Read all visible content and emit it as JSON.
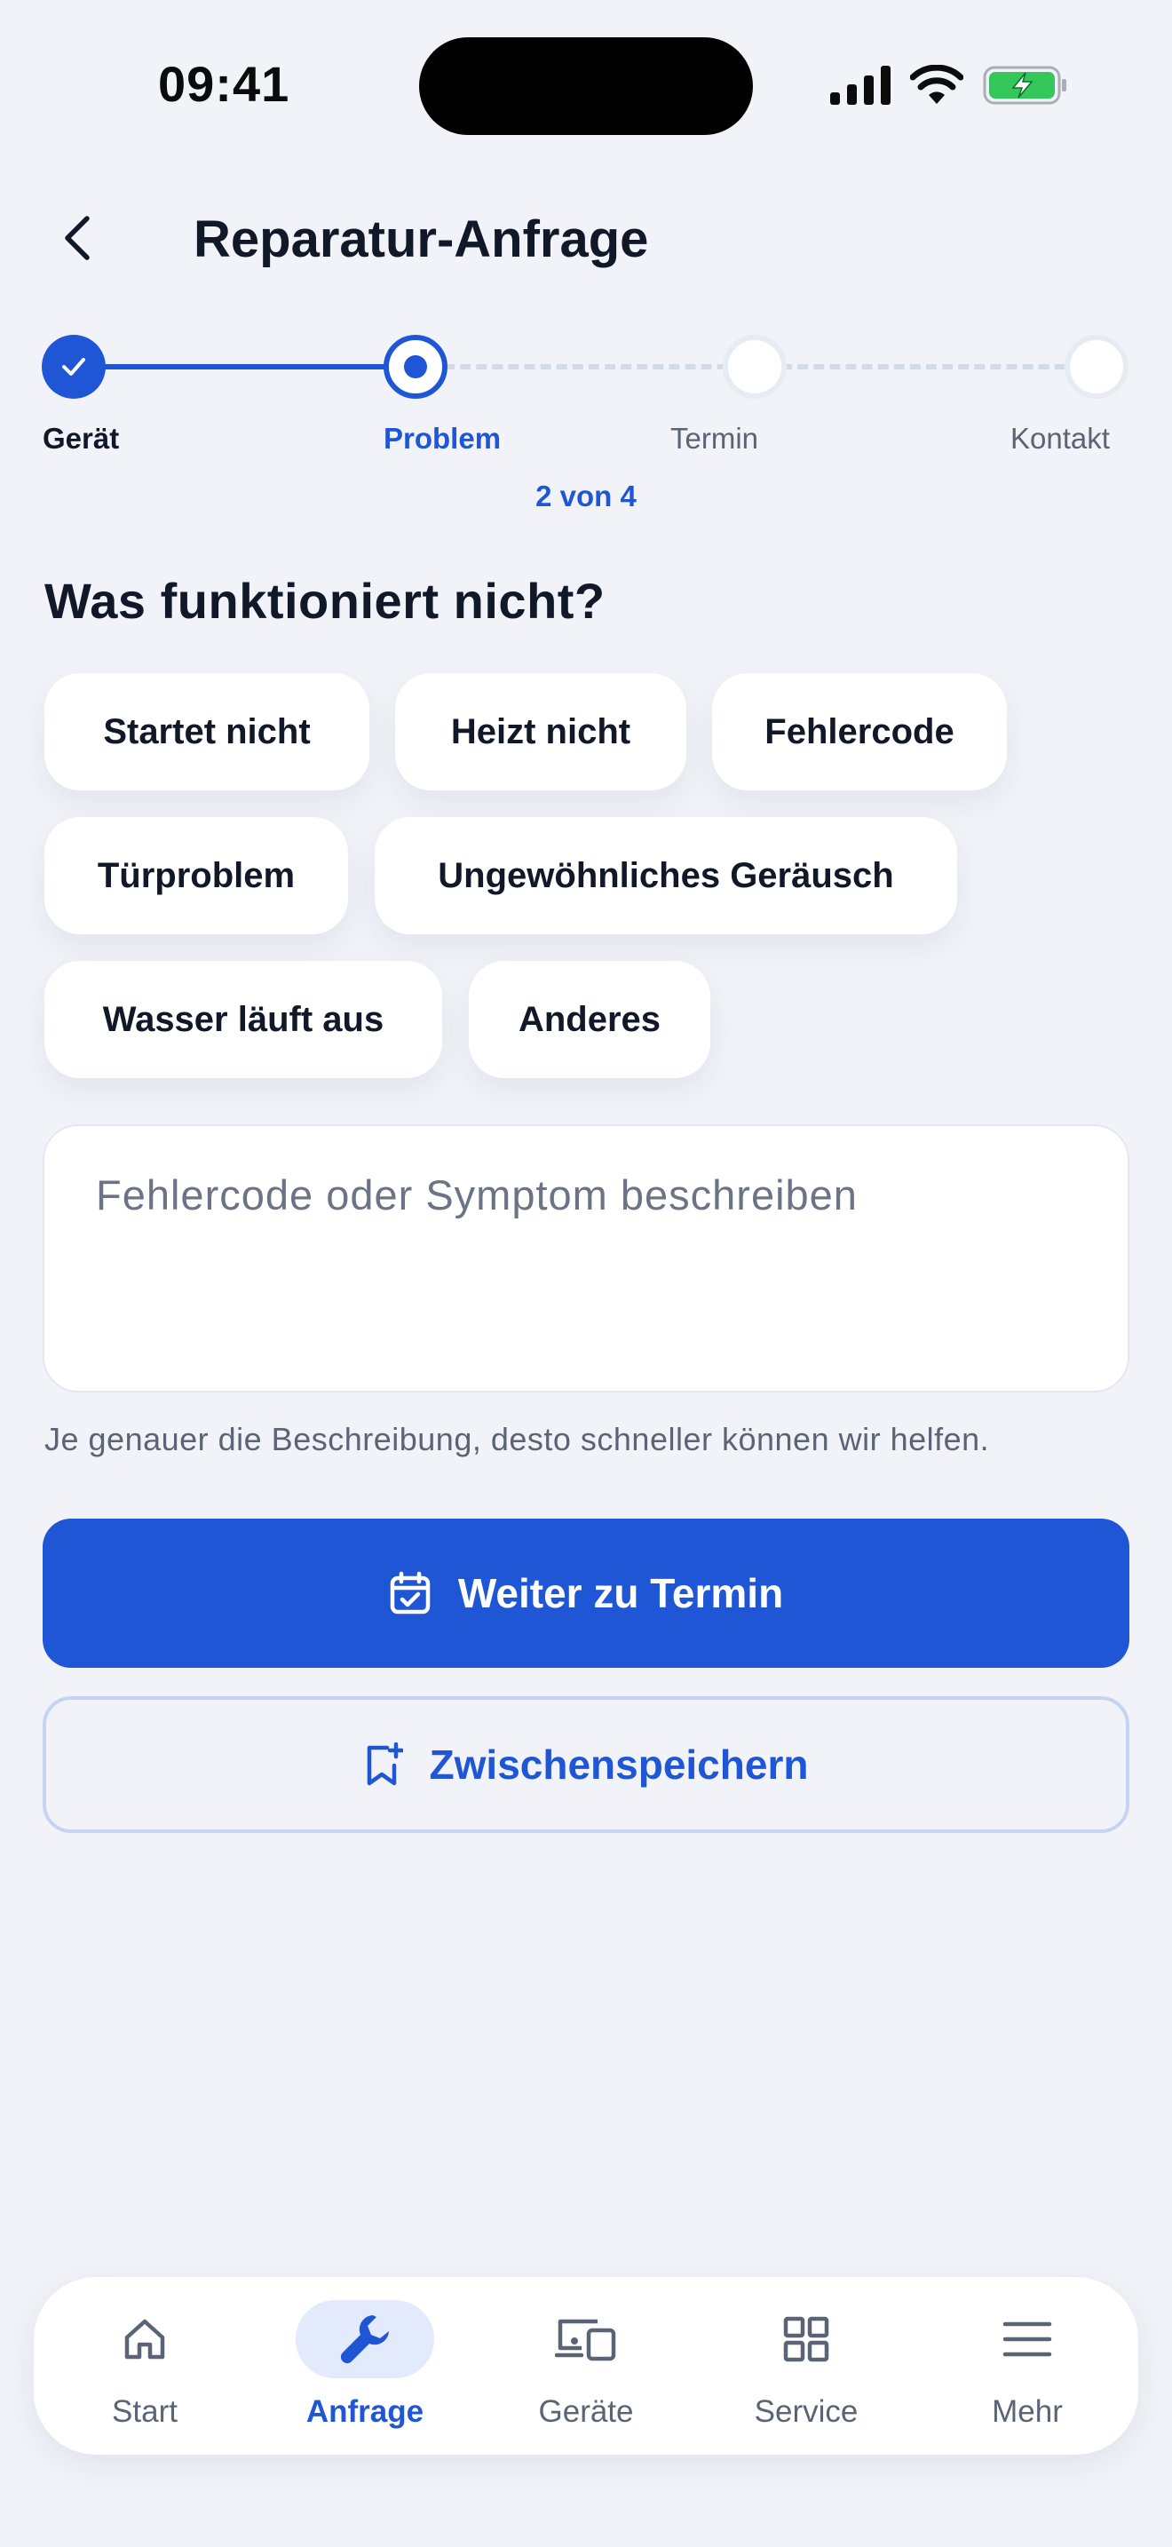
{
  "status_bar": {
    "time": "09:41"
  },
  "header": {
    "title": "Reparatur-Anfrage"
  },
  "stepper": {
    "steps": [
      {
        "label": "Gerät",
        "state": "done"
      },
      {
        "label": "Problem",
        "state": "current"
      },
      {
        "label": "Termin",
        "state": "pending"
      },
      {
        "label": "Kontakt",
        "state": "pending"
      }
    ],
    "progress_text": "2 von 4"
  },
  "question": "Was funktioniert nicht?",
  "chips": [
    "Startet nicht",
    "Heizt nicht",
    "Fehlercode",
    "Türproblem",
    "Ungewöhnliches Geräusch",
    "Wasser läuft aus",
    "Anderes"
  ],
  "description": {
    "value": "",
    "placeholder": "Fehlercode oder Symptom beschreiben",
    "helper": "Je genauer die Beschreibung, desto schneller können wir helfen."
  },
  "buttons": {
    "primary_label": "Weiter zu Termin",
    "primary_icon": "calendar-check-icon",
    "secondary_label": "Zwischenspeichern",
    "secondary_icon": "bookmark-plus-icon"
  },
  "tabbar": {
    "items": [
      {
        "label": "Start",
        "icon": "home-icon",
        "active": false
      },
      {
        "label": "Anfrage",
        "icon": "wrench-icon",
        "active": true
      },
      {
        "label": "Geräte",
        "icon": "devices-icon",
        "active": false
      },
      {
        "label": "Service",
        "icon": "grid-icon",
        "active": false
      },
      {
        "label": "Mehr",
        "icon": "menu-icon",
        "active": false
      }
    ]
  },
  "colors": {
    "accent": "#1F56D6",
    "background": "#F1F3F8",
    "text": "#111827",
    "muted": "#5B6475",
    "battery_green": "#34C759"
  }
}
